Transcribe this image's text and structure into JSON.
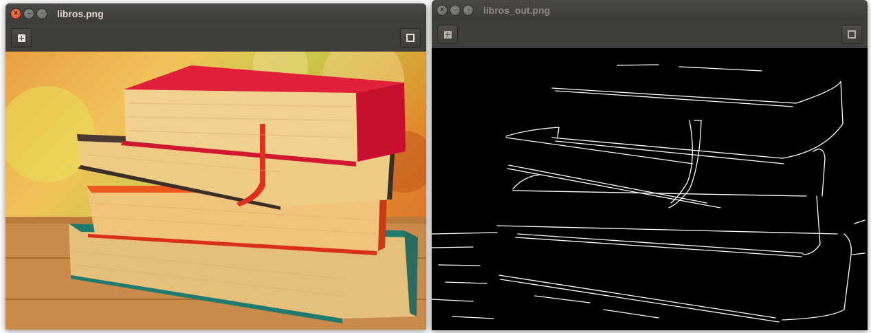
{
  "windows": {
    "left": {
      "title": "libros.png",
      "active": true
    },
    "right": {
      "title": "libros_out.png",
      "active": false
    }
  },
  "icons": {
    "close": "close-icon",
    "minimize": "minimize-icon",
    "maximize": "maximize-icon",
    "zoom_in": "plus-square-icon",
    "fullscreen": "fullscreen-icon"
  },
  "colors": {
    "titlebar": "#3c3b37",
    "close_active": "#e0542a",
    "edge_background": "#000000",
    "edge_lines": "#ffffff"
  }
}
